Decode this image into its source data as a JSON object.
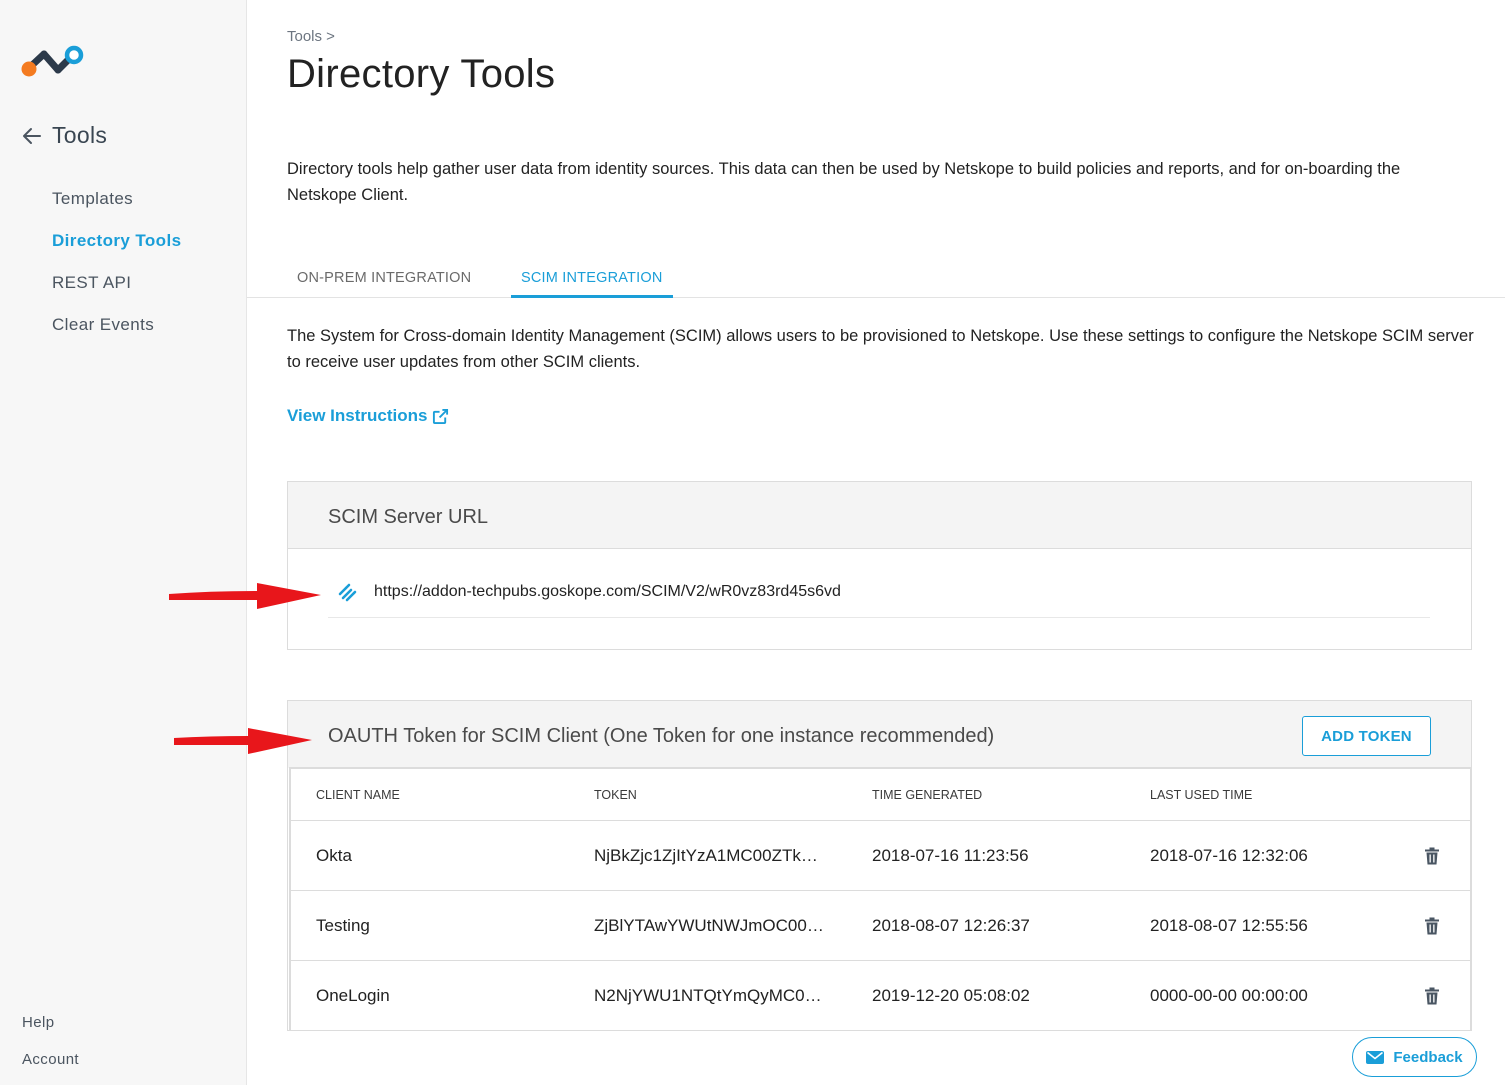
{
  "sidebar": {
    "title": "Tools",
    "items": [
      {
        "label": "Templates"
      },
      {
        "label": "Directory Tools"
      },
      {
        "label": "REST API"
      },
      {
        "label": "Clear Events"
      }
    ],
    "footer": [
      {
        "label": "Help"
      },
      {
        "label": "Account"
      }
    ]
  },
  "header": {
    "breadcrumb": "Tools >",
    "title": "Directory Tools",
    "description": "Directory tools help gather user data from identity sources. This data can then be used by Netskope to build policies and reports, and for on-boarding the Netskope Client."
  },
  "tabs": [
    {
      "label": "ON-PREM INTEGRATION"
    },
    {
      "label": "SCIM INTEGRATION"
    }
  ],
  "scim": {
    "description": "The System for Cross-domain Identity Management (SCIM) allows users to be provisioned to Netskope. Use these settings to configure the Netskope SCIM server to receive user updates from other SCIM clients.",
    "view_instructions": "View Instructions",
    "server_url_title": "SCIM Server URL",
    "server_url": "https://addon-techpubs.goskope.com/SCIM/V2/wR0vz83rd45s6vd"
  },
  "tokens": {
    "title": "OAUTH Token for SCIM Client (One Token for one instance recommended)",
    "add_button": "ADD TOKEN",
    "columns": [
      "CLIENT NAME",
      "TOKEN",
      "TIME GENERATED",
      "LAST USED TIME"
    ],
    "rows": [
      {
        "client": "Okta",
        "token": "NjBkZjc1ZjItYzA1MC00ZTk…",
        "generated": "2018-07-16 11:23:56",
        "last_used": "2018-07-16 12:32:06"
      },
      {
        "client": "Testing",
        "token": "ZjBlYTAwYWUtNWJmOC00…",
        "generated": "2018-08-07 12:26:37",
        "last_used": "2018-08-07 12:55:56"
      },
      {
        "client": "OneLogin",
        "token": "N2NjYWU1NTQtYmQyMC0…",
        "generated": "2019-12-20 05:08:02",
        "last_used": "0000-00-00 00:00:00"
      }
    ]
  },
  "feedback": {
    "label": "Feedback"
  },
  "icons": {
    "logo": "netskope-logo",
    "back": "back-arrow-icon",
    "external": "external-link-icon",
    "link": "link-icon",
    "delete": "trash-icon",
    "mail": "mail-icon"
  },
  "colors": {
    "accent": "#1a9ed8",
    "logo_orange": "#f47b20",
    "logo_dark": "#2c3a4a",
    "annotation_arrow": "#e8161b"
  }
}
